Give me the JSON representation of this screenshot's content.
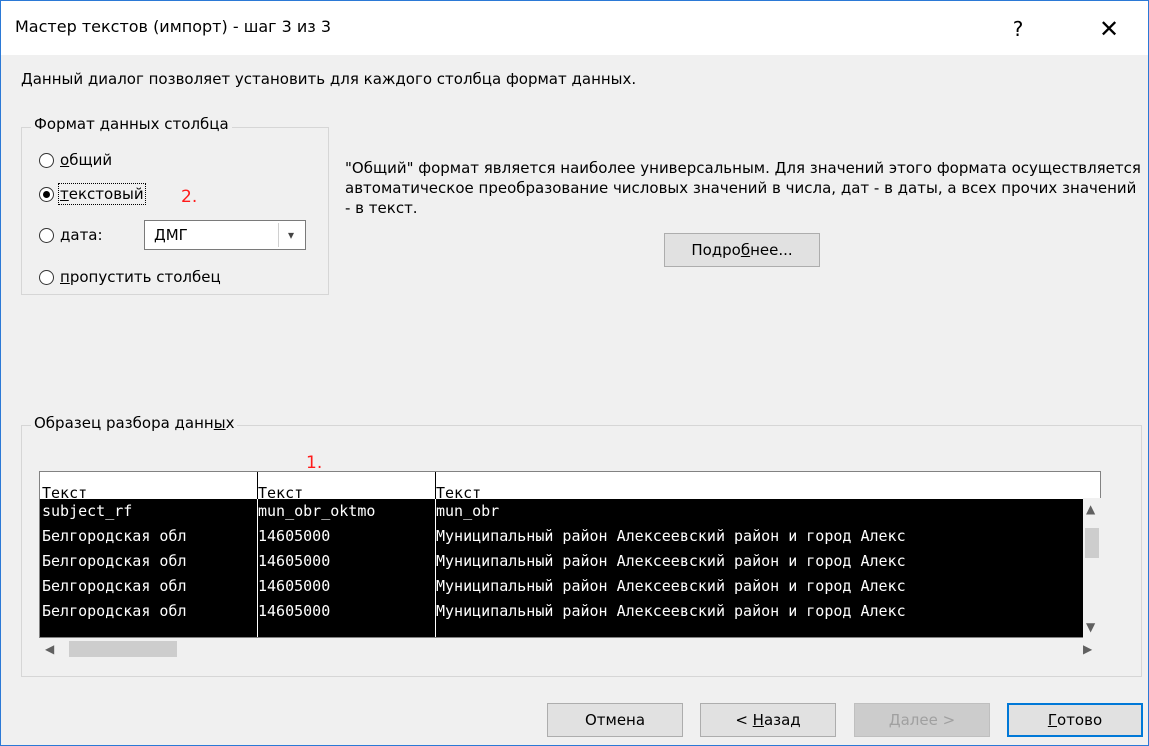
{
  "window": {
    "title": "Мастер текстов (импорт) - шаг 3 из 3",
    "help_label": "?",
    "close_label": "✕"
  },
  "intro_text": "Данный диалог позволяет установить для каждого столбца формат данных.",
  "column_format": {
    "legend": "Формат данных столбца",
    "options": {
      "general": {
        "hotkey": "о",
        "rest": "бщий"
      },
      "text": {
        "hotkey": "т",
        "rest": "екстовый"
      },
      "date": {
        "hotkey": "д",
        "rest": "ата:"
      },
      "skip": {
        "hotkey": "п",
        "rest": "ропустить столбец"
      }
    },
    "selected": "text",
    "date_format_value": "ДМГ"
  },
  "description": "\"Общий\" формат является наиболее универсальным. Для значений этого формата осуществляется автоматическое преобразование числовых значений в числа, дат - в даты, а всех прочих значений - в текст.",
  "advanced_button": {
    "prefix": "Подро",
    "hotkey": "б",
    "suffix": "нее..."
  },
  "annotations": {
    "one": "1.",
    "two": "2."
  },
  "preview": {
    "legend_prefix": "Образец разбора данн",
    "legend_hotkey": "ы",
    "legend_suffix": "х",
    "headers": [
      "Текст",
      "Текст",
      "Текст"
    ],
    "rows": [
      [
        "subject_rf",
        "mun_obr_oktmo",
        "mun_obr"
      ],
      [
        "Белгородская обл",
        "14605000",
        "Муниципальный район Алексеевский район и город Алекс"
      ],
      [
        "Белгородская обл",
        "14605000",
        "Муниципальный район Алексеевский район и город Алекс"
      ],
      [
        "Белгородская обл",
        "14605000",
        "Муниципальный район Алексеевский район и город Алекс"
      ],
      [
        "Белгородская обл",
        "14605000",
        "Муниципальный район Алексеевский район и город Алекс"
      ]
    ]
  },
  "buttons": {
    "cancel": "Отмена",
    "back_prefix": "< ",
    "back_hotkey": "Н",
    "back_rest": "азад",
    "next_hotkey": "Д",
    "next_rest": "алее >",
    "finish_hotkey": "Г",
    "finish_rest": "отово"
  },
  "icons": {
    "arrow_up": "▲",
    "arrow_down": "▼",
    "arrow_left": "◀",
    "arrow_right": "▶",
    "combo_chevron": "▾"
  }
}
